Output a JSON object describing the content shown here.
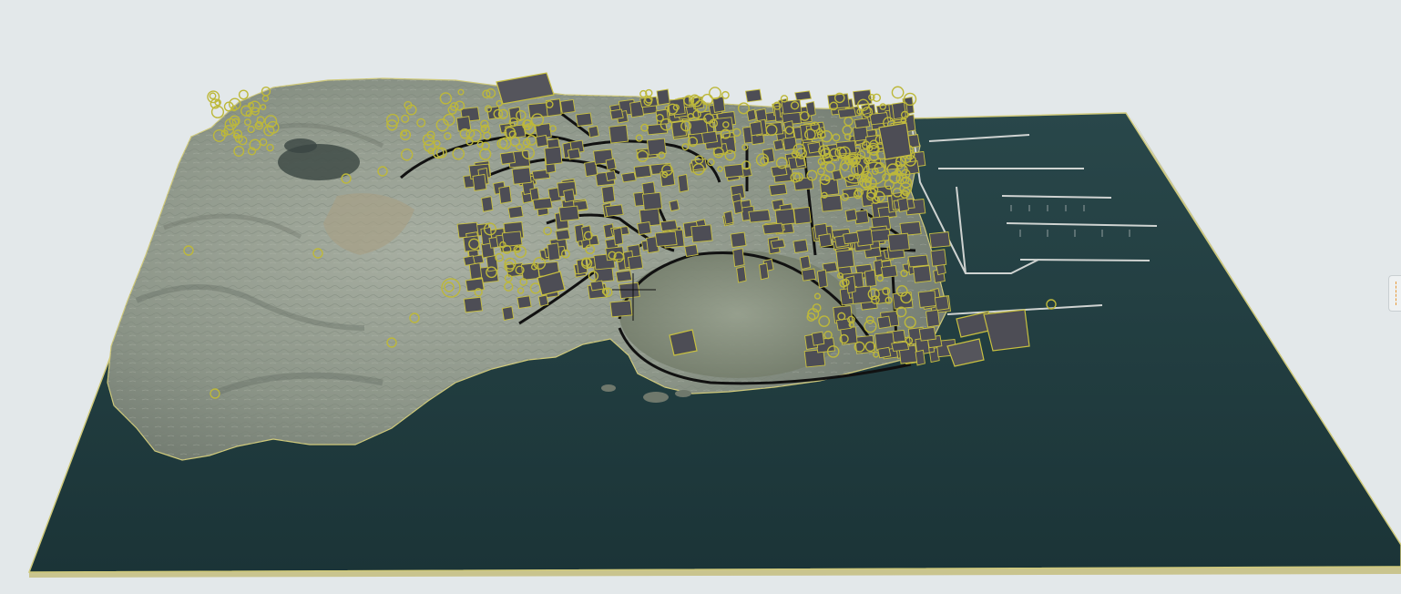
{
  "viewport": {
    "background": "#e3e8ea",
    "water_color": "#1f3a3d",
    "terrain_color": "#8f9a90",
    "building_color": "#4d4d55",
    "outline_color": "#c8c040",
    "tree_color": "#bdb83a",
    "cursor": "crosshair-icon"
  },
  "side_panel": {
    "handle_icon": "drag-handle-icon",
    "accent": "#e79a3a"
  }
}
